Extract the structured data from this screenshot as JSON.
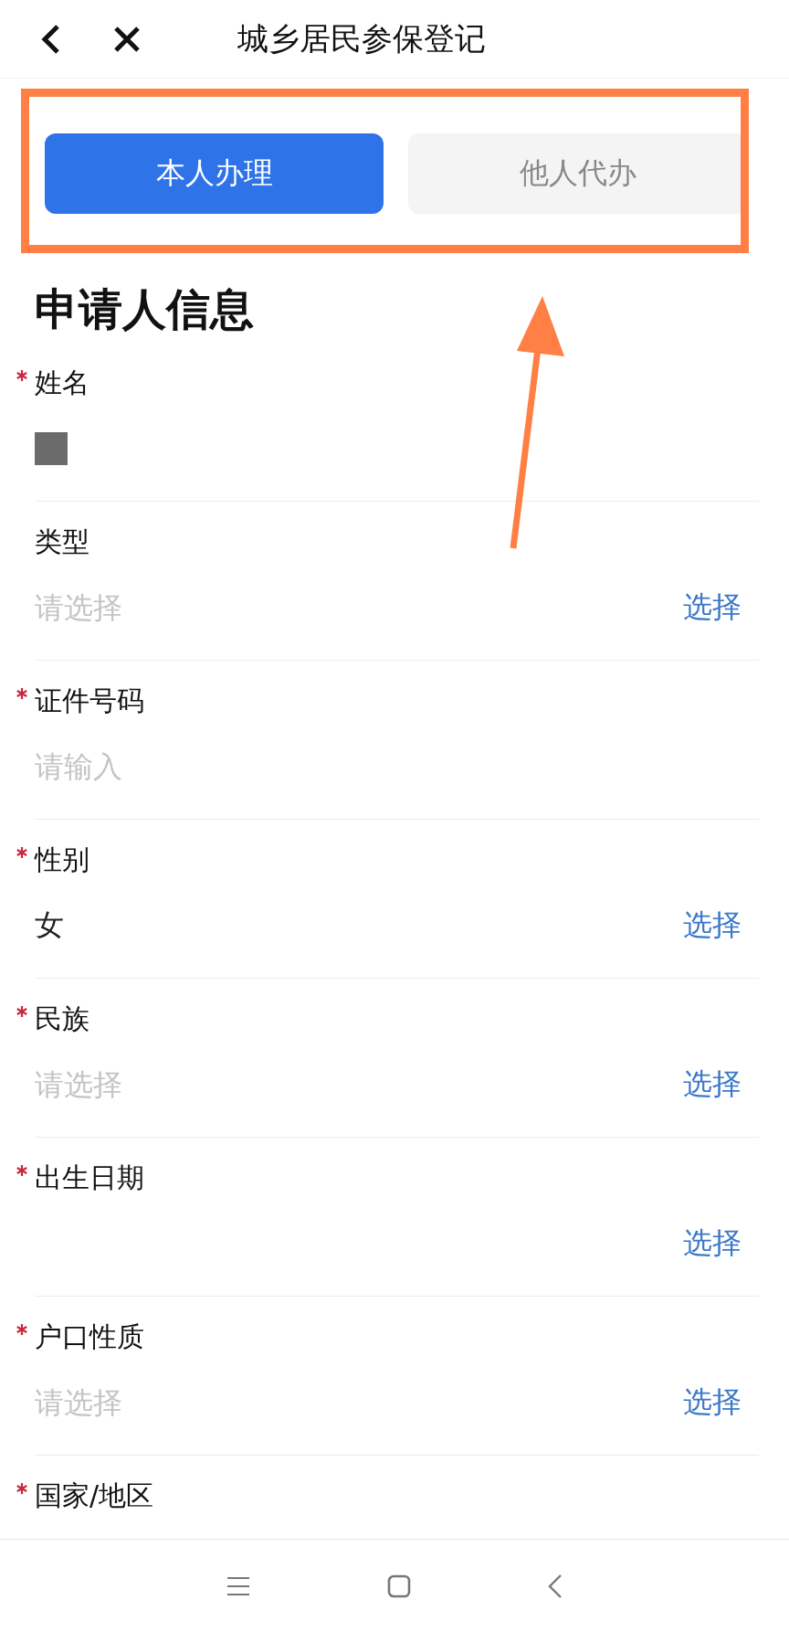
{
  "header": {
    "title": "城乡居民参保登记"
  },
  "tabs": [
    {
      "label": "本人办理",
      "selected": true
    },
    {
      "label": "他人代办",
      "selected": false
    }
  ],
  "section": {
    "title": "申请人信息"
  },
  "fields": [
    {
      "kind": "text",
      "label": "姓名",
      "required": true,
      "redacted": true
    },
    {
      "kind": "select",
      "label": "类型",
      "required": false,
      "placeholder": "请选择",
      "action": "选择"
    },
    {
      "kind": "text",
      "label": "证件号码",
      "required": true,
      "placeholder": "请输入"
    },
    {
      "kind": "select",
      "label": "性别",
      "required": true,
      "value": "女",
      "action": "选择"
    },
    {
      "kind": "select",
      "label": "民族",
      "required": true,
      "placeholder": "请选择",
      "action": "选择"
    },
    {
      "kind": "select",
      "label": "出生日期",
      "required": true,
      "action": "选择"
    },
    {
      "kind": "select",
      "label": "户口性质",
      "required": true,
      "placeholder": "请选择",
      "action": "选择"
    },
    {
      "kind": "partial",
      "label": "国家/地区",
      "required": true
    }
  ]
}
